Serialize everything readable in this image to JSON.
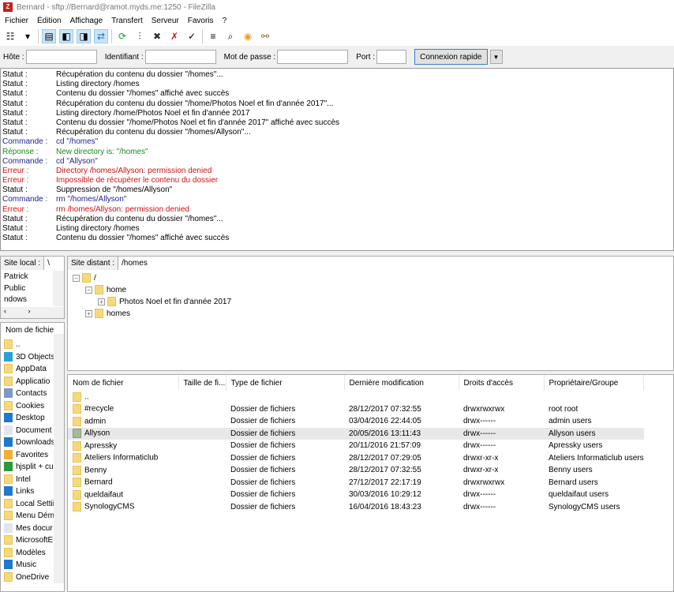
{
  "window": {
    "title": "Bernard - sftp://Bernard@ramot.myds.me:1250 - FileZilla"
  },
  "menu": [
    "Fichier",
    "Édition",
    "Affichage",
    "Transfert",
    "Serveur",
    "Favoris",
    "?"
  ],
  "toolbar": {
    "icons": [
      "site-manager-icon",
      "dropdown-icon",
      "message-log-icon",
      "local-tree-icon",
      "remote-tree-icon",
      "transfer-queue-icon",
      "refresh-icon",
      "process-queue-icon",
      "cancel-icon",
      "disconnect-icon",
      "reconnect-icon",
      "filter-icon",
      "compare-icon",
      "sync-browse-icon",
      "search-icon"
    ]
  },
  "quickconnect": {
    "host_label": "Hôte :",
    "host_value": "",
    "user_label": "Identifiant :",
    "user_value": "",
    "pass_label": "Mot de passe :",
    "pass_value": "",
    "port_label": "Port :",
    "port_value": "",
    "connect_label": "Connexion rapide"
  },
  "log": [
    {
      "type": "Statut",
      "label": "Statut :",
      "msg": "Récupération du contenu du dossier \"/homes\"..."
    },
    {
      "type": "Statut",
      "label": "Statut :",
      "msg": "Listing directory /homes"
    },
    {
      "type": "Statut",
      "label": "Statut :",
      "msg": "Contenu du dossier \"/homes\" affiché avec succès"
    },
    {
      "type": "Statut",
      "label": "Statut :",
      "msg": "Récupération du contenu du dossier \"/home/Photos Noel et fin d'année 2017\"..."
    },
    {
      "type": "Statut",
      "label": "Statut :",
      "msg": "Listing directory /home/Photos Noel et fin d'année 2017"
    },
    {
      "type": "Statut",
      "label": "Statut :",
      "msg": "Contenu du dossier \"/home/Photos Noel et fin d'année 2017\" affiché avec succès"
    },
    {
      "type": "Statut",
      "label": "Statut :",
      "msg": "Récupération du contenu du dossier \"/homes/Allyson\"..."
    },
    {
      "type": "Commande",
      "label": "Commande :",
      "msg": "cd \"/homes\""
    },
    {
      "type": "Reponse",
      "label": "Réponse :",
      "msg": "New directory is: \"/homes\""
    },
    {
      "type": "Commande",
      "label": "Commande :",
      "msg": "cd \"Allyson\""
    },
    {
      "type": "Erreur",
      "label": "Erreur :",
      "msg": "Directory /homes/Allyson: permission denied"
    },
    {
      "type": "Erreur",
      "label": "Erreur :",
      "msg": "Impossible de récupérer le contenu du dossier"
    },
    {
      "type": "Statut",
      "label": "Statut :",
      "msg": "Suppression de \"/homes/Allyson\""
    },
    {
      "type": "Commande",
      "label": "Commande :",
      "msg": "rm \"/homes/Allyson\""
    },
    {
      "type": "Erreur",
      "label": "Erreur :",
      "msg": "rm /homes/Allyson: permission denied"
    },
    {
      "type": "Statut",
      "label": "Statut :",
      "msg": "Récupération du contenu du dossier \"/homes\"..."
    },
    {
      "type": "Statut",
      "label": "Statut :",
      "msg": "Listing directory /homes"
    },
    {
      "type": "Statut",
      "label": "Statut :",
      "msg": "Contenu du dossier \"/homes\" affiché avec succès"
    }
  ],
  "local": {
    "site_label": "Site local :",
    "site_value": "\\",
    "tree": [
      "Patrick",
      "Public",
      "ndows"
    ],
    "column": "Nom de fichie",
    "files": [
      {
        "name": "..",
        "icon": "folder-icon"
      },
      {
        "name": "3D Objects",
        "icon": "3d-objects-icon"
      },
      {
        "name": "AppData",
        "icon": "folder-icon"
      },
      {
        "name": "Applicatio",
        "icon": "folder-icon"
      },
      {
        "name": "Contacts",
        "icon": "contacts-icon"
      },
      {
        "name": "Cookies",
        "icon": "folder-icon"
      },
      {
        "name": "Desktop",
        "icon": "desktop-icon"
      },
      {
        "name": "Document",
        "icon": "document-icon"
      },
      {
        "name": "Downloads",
        "icon": "download-icon"
      },
      {
        "name": "Favorites",
        "icon": "star-icon"
      },
      {
        "name": "hjsplit + cu",
        "icon": "app-icon"
      },
      {
        "name": "Intel",
        "icon": "folder-icon"
      },
      {
        "name": "Links",
        "icon": "link-icon"
      },
      {
        "name": "Local Settii",
        "icon": "folder-icon"
      },
      {
        "name": "Menu Dém",
        "icon": "folder-icon"
      },
      {
        "name": "Mes docur",
        "icon": "document-icon"
      },
      {
        "name": "MicrosoftE",
        "icon": "folder-icon"
      },
      {
        "name": "Modèles",
        "icon": "folder-icon"
      },
      {
        "name": "Music",
        "icon": "music-icon"
      },
      {
        "name": "OneDrive",
        "icon": "folder-icon"
      }
    ]
  },
  "remote": {
    "site_label": "Site distant :",
    "site_value": "/homes",
    "tree": [
      {
        "name": "/",
        "level": 0,
        "toggle": "−"
      },
      {
        "name": "home",
        "level": 1,
        "toggle": "−"
      },
      {
        "name": "Photos Noel et fin d'année 2017",
        "level": 2,
        "toggle": "+"
      },
      {
        "name": "homes",
        "level": 1,
        "toggle": "+"
      }
    ],
    "columns": [
      "Nom de fichier",
      "Taille de fi...",
      "Type de fichier",
      "Dernière modification",
      "Droits d'accès",
      "Propriétaire/Groupe"
    ],
    "files": [
      {
        "name": "..",
        "size": "",
        "type": "",
        "modified": "",
        "perms": "",
        "owner": ""
      },
      {
        "name": "#recycle",
        "size": "",
        "type": "Dossier de fichiers",
        "modified": "28/12/2017 07:32:55",
        "perms": "drwxrwxrwx",
        "owner": "root root"
      },
      {
        "name": "admin",
        "size": "",
        "type": "Dossier de fichiers",
        "modified": "03/04/2016 22:44:05",
        "perms": "drwx------",
        "owner": "admin users"
      },
      {
        "name": "Allyson",
        "size": "",
        "type": "Dossier de fichiers",
        "modified": "20/05/2016 13:11:43",
        "perms": "drwx------",
        "owner": "Allyson users",
        "highlighted": true
      },
      {
        "name": "Apressky",
        "size": "",
        "type": "Dossier de fichiers",
        "modified": "20/11/2016 21:57:09",
        "perms": "drwx------",
        "owner": "Apressky users"
      },
      {
        "name": "Ateliers Informaticlub",
        "size": "",
        "type": "Dossier de fichiers",
        "modified": "28/12/2017 07:29:05",
        "perms": "drwxr-xr-x",
        "owner": "Ateliers Informaticlub users"
      },
      {
        "name": "Benny",
        "size": "",
        "type": "Dossier de fichiers",
        "modified": "28/12/2017 07:32:55",
        "perms": "drwxr-xr-x",
        "owner": "Benny users"
      },
      {
        "name": "Bernard",
        "size": "",
        "type": "Dossier de fichiers",
        "modified": "27/12/2017 22:17:19",
        "perms": "drwxrwxrwx",
        "owner": "Bernard users"
      },
      {
        "name": "queldaifaut",
        "size": "",
        "type": "Dossier de fichiers",
        "modified": "30/03/2016 10:29:12",
        "perms": "drwx------",
        "owner": "queldaifaut users"
      },
      {
        "name": "SynologyCMS",
        "size": "",
        "type": "Dossier de fichiers",
        "modified": "16/04/2016 18:43:23",
        "perms": "drwx------",
        "owner": "SynologyCMS users"
      }
    ]
  },
  "colors": {
    "status": "#000000",
    "command": "#1f1f8f",
    "response": "#1a8a1a",
    "error": "#d01010",
    "folder": "#f7d97a"
  }
}
